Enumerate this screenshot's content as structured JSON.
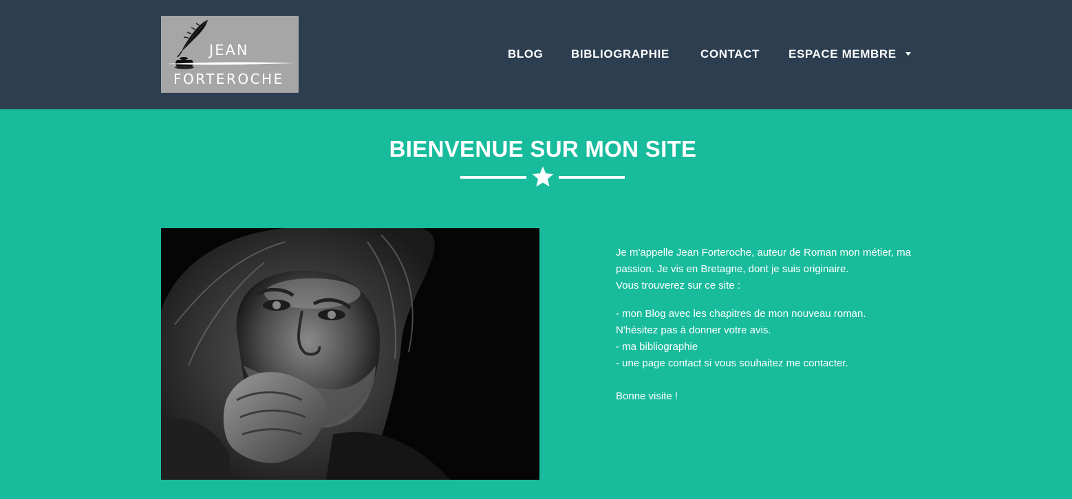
{
  "brand": {
    "first_name": "JEAN",
    "last_name": "FORTEROCHE",
    "logo_icon": "quill-inkwell-icon"
  },
  "nav": {
    "blog": "BLOG",
    "bibliographie": "BIBLIOGRAPHIE",
    "contact": "CONTACT",
    "espace_membre": "ESPACE MEMBRE",
    "dropdown_icon": "caret-down-icon"
  },
  "hero": {
    "title": "BIENVENUE SUR MON SITE",
    "divider_icon": "star-icon"
  },
  "portrait": {
    "description": "black-and-white portrait photo"
  },
  "bio": {
    "intro": [
      "Je m'appelle Jean Forteroche, auteur de Roman mon métier, ma",
      "passion. Je vis en Bretagne, dont je suis originaire.",
      "Vous trouverez sur ce site :"
    ],
    "list": [
      "- mon Blog avec les chapitres de mon nouveau roman.",
      "N'hésitez pas à donner votre avis.",
      "- ma bibliographie",
      "- une page contact si vous souhaitez me contacter."
    ],
    "closing": "Bonne visite !"
  },
  "colors": {
    "navbar": "#2c3e50",
    "background": "#18bc9c",
    "text": "#ffffff",
    "logo_bg": "#a6a6a6"
  }
}
